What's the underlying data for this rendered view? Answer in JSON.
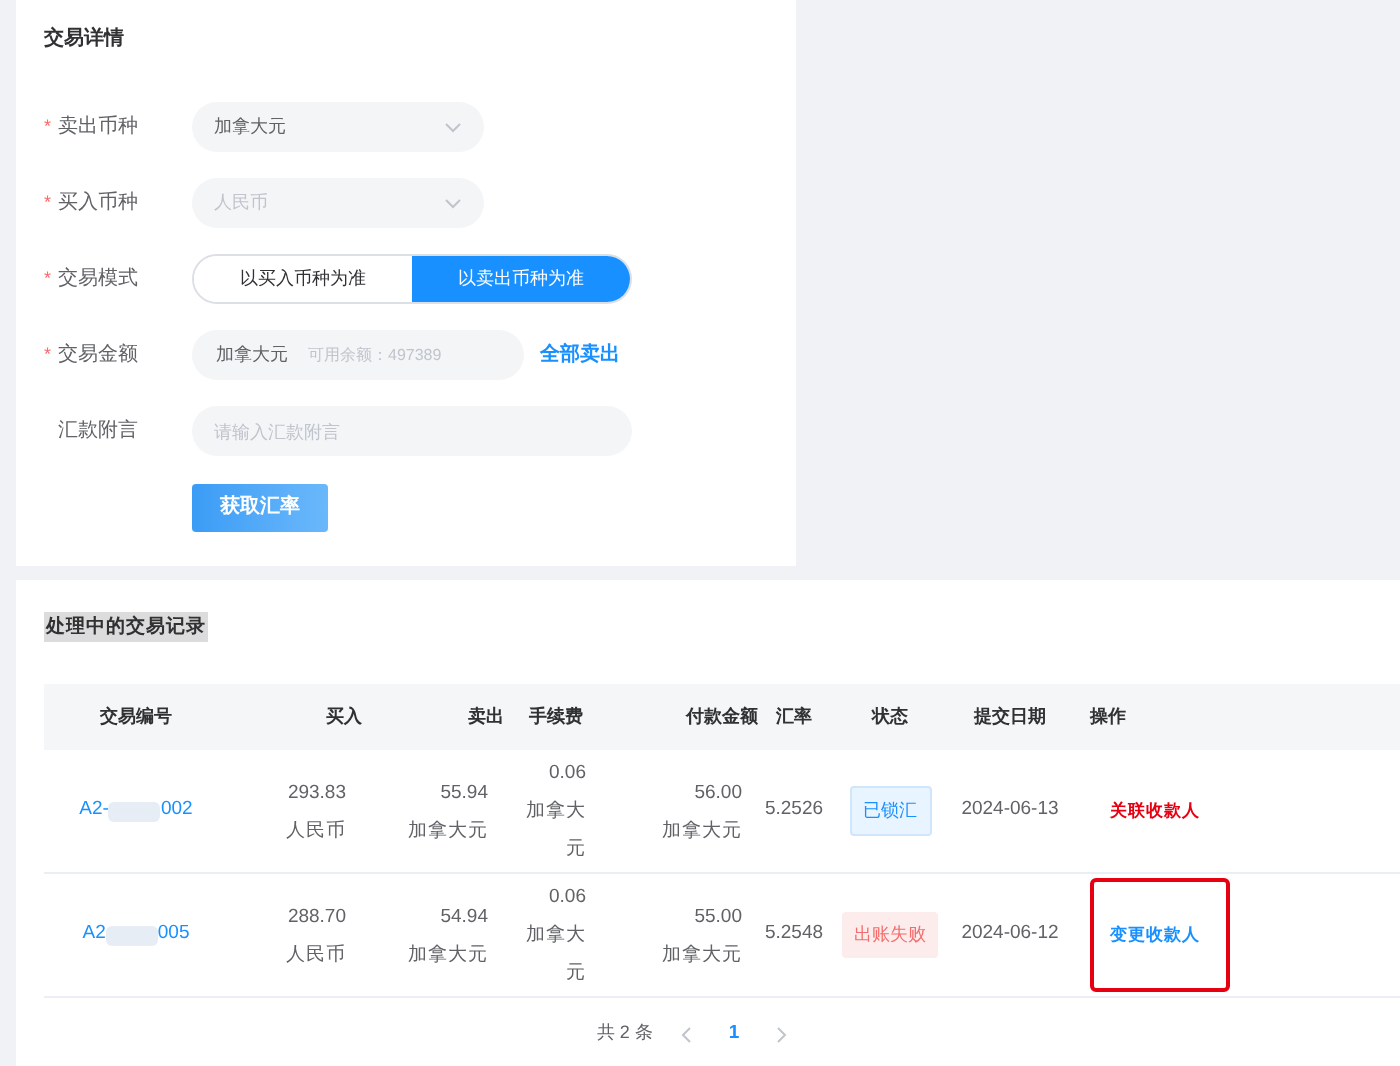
{
  "form": {
    "title": "交易详情",
    "fields": [
      {
        "kind": "select",
        "label": "卖出币种",
        "required_mark": "*",
        "value": "加拿大元",
        "disabled": false
      },
      {
        "kind": "select",
        "label": "买入币种",
        "required_mark": "*",
        "value": "人民币",
        "disabled": true
      },
      {
        "kind": "toggle",
        "label": "交易模式",
        "required_mark": "*",
        "options": [
          {
            "label": "以买入币种为准",
            "selected": false
          },
          {
            "label": "以卖出币种为准",
            "selected": true
          }
        ]
      },
      {
        "kind": "amount",
        "label": "交易金额",
        "required_mark": "*",
        "currency": "加拿大元",
        "placeholder": "可用余额：497389",
        "link": "全部卖出"
      },
      {
        "kind": "text",
        "label": "汇款附言",
        "placeholder": "请输入汇款附言"
      }
    ],
    "button": "获取汇率"
  },
  "records": {
    "title": "处理中的交易记录",
    "columns": [
      "交易编号",
      "买入",
      "卖出",
      "手续费",
      "付款金额",
      "汇率",
      "状态",
      "提交日期",
      "操作"
    ],
    "rows": [
      {
        "id_start": "A2-",
        "id_end": "002",
        "buy": "293.83",
        "buy_currency": "人民币",
        "sell": "55.94",
        "sell_currency": "加拿大元",
        "fee": "0.06",
        "fee_currency": [
          "加拿大",
          "元"
        ],
        "payment": "56.00",
        "payment_currency": "加拿大元",
        "rate": "5.2526",
        "status": {
          "label": "已锁汇",
          "kind": "locked"
        },
        "date": "2024-06-13",
        "action": {
          "label": "关联收款人",
          "kind": "danger"
        },
        "highlighted": false
      },
      {
        "id_start": "A2",
        "id_end": "005",
        "buy": "288.70",
        "buy_currency": "人民币",
        "sell": "54.94",
        "sell_currency": "加拿大元",
        "fee": "0.06",
        "fee_currency": [
          "加拿大",
          "元"
        ],
        "payment": "55.00",
        "payment_currency": "加拿大元",
        "rate": "5.2548",
        "status": {
          "label": "出账失败",
          "kind": "failed"
        },
        "date": "2024-06-12",
        "action": {
          "label": "变更收款人",
          "kind": "primary"
        },
        "highlighted": true
      }
    ],
    "pagination": {
      "total": "共 2 条",
      "pages": [
        {
          "label": "1",
          "selected": true
        }
      ]
    }
  }
}
